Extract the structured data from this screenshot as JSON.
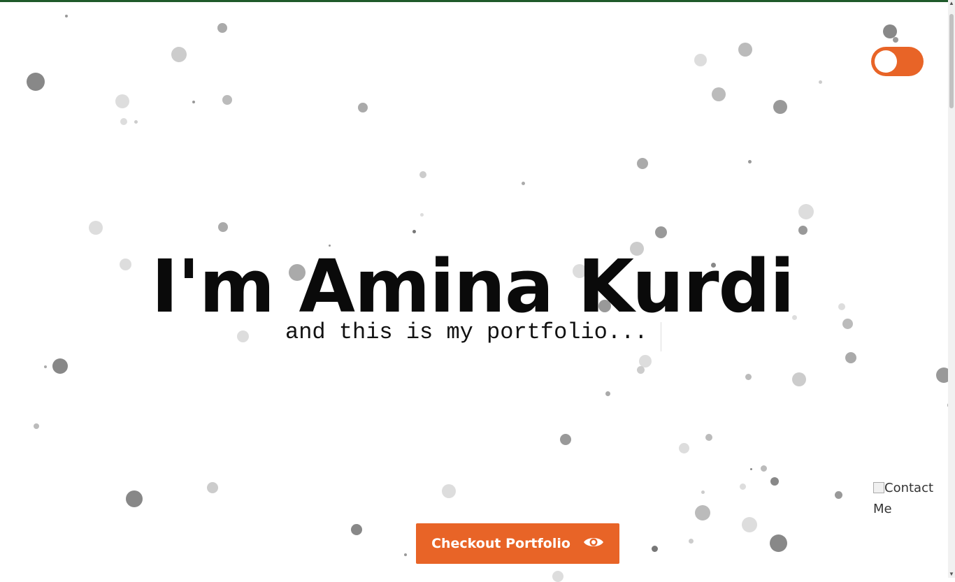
{
  "hero": {
    "title": "I'm Amina Kurdi",
    "subtitle": "and this is my portfolio..."
  },
  "cta": {
    "label": "Checkout Portfolio",
    "icon": "eye-icon"
  },
  "contact": {
    "alt": "Contact Me"
  },
  "theme_toggle": {
    "state": "off",
    "color": "#e86427"
  },
  "colors": {
    "accent": "#e86427",
    "top_bar": "#1f5a2a"
  }
}
